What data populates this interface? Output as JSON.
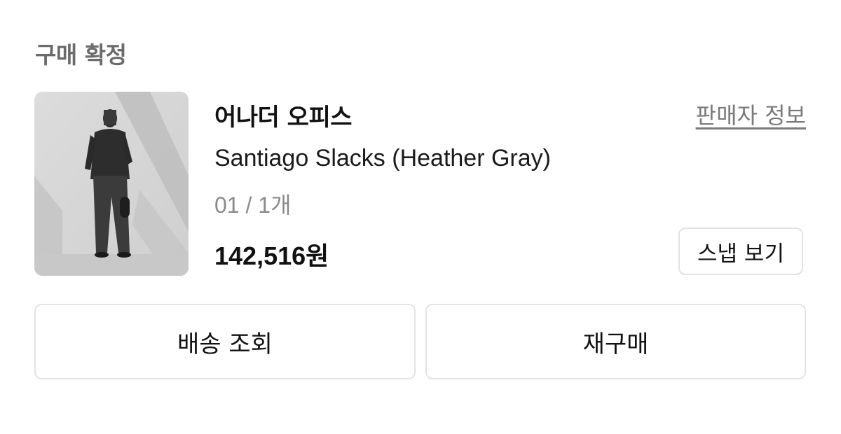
{
  "order": {
    "status_title": "구매 확정"
  },
  "product": {
    "brand": "어나더 오피스",
    "name": "Santiago Slacks (Heather Gray)",
    "option": "01 / 1개",
    "price": "142,516원",
    "image_description": "product-photo"
  },
  "links": {
    "seller_info": "판매자 정보"
  },
  "buttons": {
    "snap": "스냅 보기",
    "tracking": "배송 조회",
    "reorder": "재구매"
  },
  "colors": {
    "heading_gray": "#6b6b6b",
    "border_gray": "#e3e3e3",
    "option_gray": "#8a8a8a",
    "text_dark": "#111111"
  }
}
